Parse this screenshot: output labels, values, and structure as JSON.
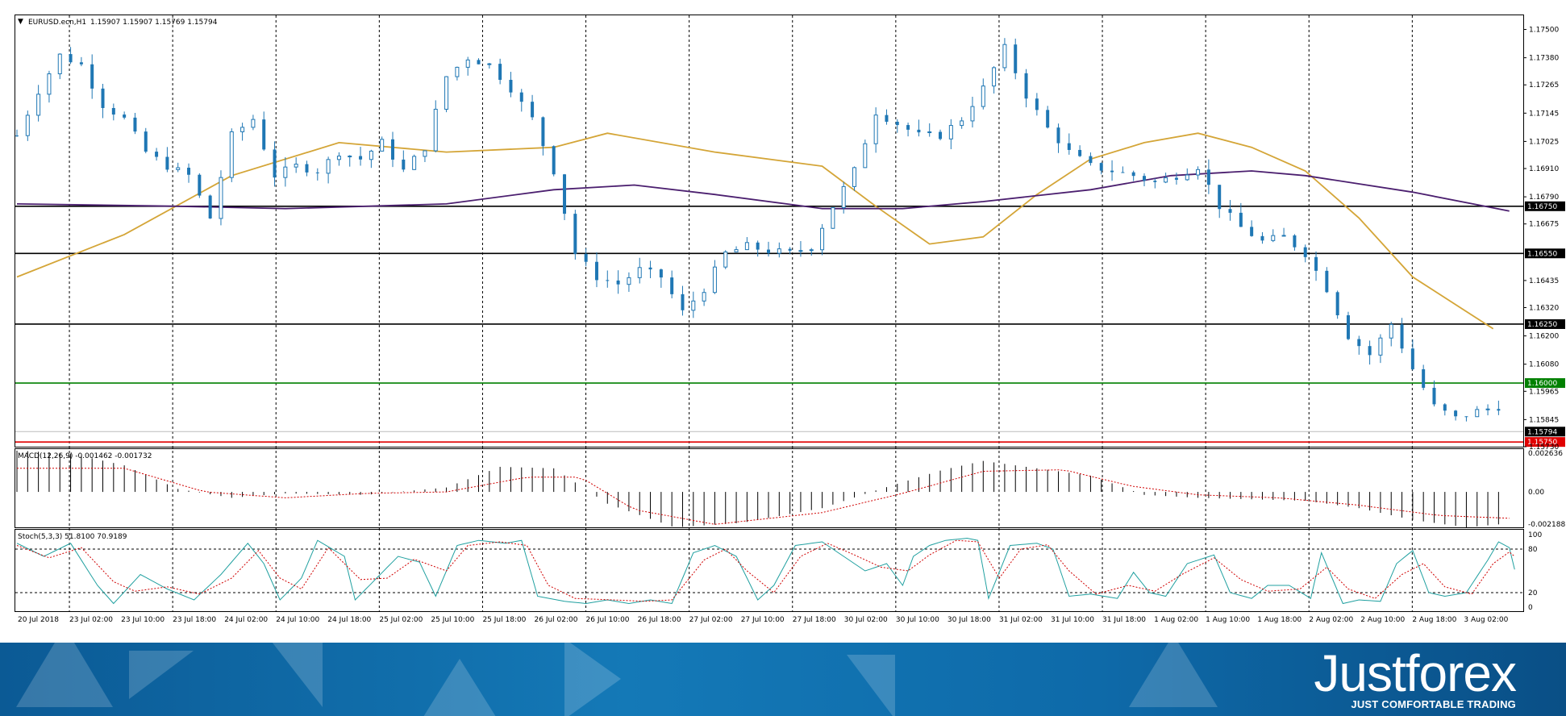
{
  "window": {
    "symbol_title": "EURUSD.ecn,H1",
    "ohlc": "1.15907 1.15907 1.15769 1.15794"
  },
  "indicators": {
    "macd_label": "MACD(12,26,9) -0.001462 -0.001732",
    "stoch_label": "Stoch(5,3,3) 51.8100 70.9189"
  },
  "brand": {
    "name": "Justforex",
    "tagline": "JUST COMFORTABLE TRADING"
  },
  "colors": {
    "candle": "#1f77b4",
    "ma_fast": "#d4a537",
    "ma_slow": "#4b1f6f",
    "support_line": "#000000",
    "green_level": "#008000",
    "red_level": "#e00000",
    "macd_signal": "#d00000",
    "stoch_main": "#20a0a0",
    "stoch_signal": "#d00000"
  },
  "chart_data": [
    {
      "type": "candlestick",
      "title": "EURUSD.ecn,H1",
      "ylim": [
        1.1573,
        1.1756
      ],
      "y_ticks": [
        "1.17500",
        "1.17380",
        "1.17265",
        "1.17145",
        "1.17025",
        "1.16910",
        "1.16790",
        "1.16675",
        "1.16435",
        "1.16320",
        "1.16200",
        "1.16080",
        "1.15965",
        "1.15845",
        "1.15730"
      ],
      "x_ticks": [
        "20 Jul 2018",
        "23 Jul 02:00",
        "23 Jul 10:00",
        "23 Jul 18:00",
        "24 Jul 02:00",
        "24 Jul 10:00",
        "24 Jul 18:00",
        "25 Jul 02:00",
        "25 Jul 10:00",
        "25 Jul 18:00",
        "26 Jul 02:00",
        "26 Jul 10:00",
        "26 Jul 18:00",
        "27 Jul 02:00",
        "27 Jul 10:00",
        "27 Jul 18:00",
        "30 Jul 02:00",
        "30 Jul 10:00",
        "30 Jul 18:00",
        "31 Jul 02:00",
        "31 Jul 10:00",
        "31 Jul 18:00",
        "1 Aug 02:00",
        "1 Aug 10:00",
        "1 Aug 18:00",
        "2 Aug 02:00",
        "2 Aug 10:00",
        "2 Aug 18:00",
        "3 Aug 02:00"
      ],
      "horizontal_levels": [
        {
          "value": 1.1675,
          "label": "1.16750",
          "color": "#000000"
        },
        {
          "value": 1.1655,
          "label": "1.16550",
          "color": "#000000"
        },
        {
          "value": 1.1625,
          "label": "1.16250",
          "color": "#000000"
        },
        {
          "value": 1.16,
          "label": "1.16000",
          "color": "#008000"
        },
        {
          "value": 1.1575,
          "label": "1.15750",
          "color": "#e00000"
        }
      ],
      "current_price": {
        "value": 1.15794,
        "label": "1.15794"
      },
      "close_path": [
        [
          0,
          1.1705
        ],
        [
          8,
          1.1724
        ],
        [
          16,
          1.1739
        ],
        [
          24,
          1.1735
        ],
        [
          32,
          1.1718
        ],
        [
          40,
          1.1712
        ],
        [
          48,
          1.1698
        ],
        [
          56,
          1.1692
        ],
        [
          64,
          1.1688
        ],
        [
          72,
          1.167
        ],
        [
          80,
          1.1705
        ],
        [
          88,
          1.1712
        ],
        [
          96,
          1.1688
        ],
        [
          104,
          1.1692
        ],
        [
          112,
          1.169
        ],
        [
          120,
          1.1698
        ],
        [
          128,
          1.1695
        ],
        [
          136,
          1.1702
        ],
        [
          144,
          1.169
        ],
        [
          152,
          1.17
        ],
        [
          160,
          1.173
        ],
        [
          168,
          1.1738
        ],
        [
          176,
          1.1735
        ],
        [
          184,
          1.1725
        ],
        [
          192,
          1.1712
        ],
        [
          200,
          1.169
        ],
        [
          208,
          1.1655
        ],
        [
          216,
          1.1645
        ],
        [
          224,
          1.1642
        ],
        [
          232,
          1.1648
        ],
        [
          240,
          1.1645
        ],
        [
          248,
          1.163
        ],
        [
          256,
          1.164
        ],
        [
          264,
          1.1655
        ],
        [
          272,
          1.1658
        ],
        [
          280,
          1.1656
        ],
        [
          288,
          1.1655
        ],
        [
          296,
          1.1658
        ],
        [
          304,
          1.1675
        ],
        [
          312,
          1.169
        ],
        [
          320,
          1.1715
        ],
        [
          328,
          1.171
        ],
        [
          336,
          1.1705
        ],
        [
          344,
          1.1705
        ],
        [
          352,
          1.1712
        ],
        [
          360,
          1.1725
        ],
        [
          368,
          1.1742
        ],
        [
          376,
          1.1722
        ],
        [
          384,
          1.1708
        ],
        [
          392,
          1.1698
        ],
        [
          400,
          1.1692
        ],
        [
          408,
          1.169
        ],
        [
          416,
          1.1688
        ],
        [
          424,
          1.1685
        ],
        [
          432,
          1.1688
        ],
        [
          440,
          1.1692
        ],
        [
          448,
          1.1675
        ],
        [
          456,
          1.1666
        ],
        [
          464,
          1.166
        ],
        [
          472,
          1.1662
        ],
        [
          480,
          1.1655
        ],
        [
          488,
          1.164
        ],
        [
          496,
          1.162
        ],
        [
          504,
          1.1612
        ],
        [
          512,
          1.1625
        ],
        [
          520,
          1.1606
        ],
        [
          528,
          1.159
        ],
        [
          536,
          1.1585
        ],
        [
          544,
          1.1588
        ],
        [
          552,
          1.159
        ],
        [
          558,
          1.1579
        ]
      ],
      "series": [
        {
          "name": "",
          "color": "#d4a537",
          "values": [
            [
              0,
              1.1645
            ],
            [
              40,
              1.1663
            ],
            [
              80,
              1.1688
            ],
            [
              120,
              1.1702
            ],
            [
              160,
              1.1698
            ],
            [
              200,
              1.17
            ],
            [
              220,
              1.1706
            ],
            [
              260,
              1.1698
            ],
            [
              300,
              1.1692
            ],
            [
              320,
              1.1675
            ],
            [
              340,
              1.1659
            ],
            [
              360,
              1.1662
            ],
            [
              380,
              1.168
            ],
            [
              400,
              1.1695
            ],
            [
              420,
              1.1702
            ],
            [
              440,
              1.1706
            ],
            [
              460,
              1.17
            ],
            [
              480,
              1.169
            ],
            [
              500,
              1.167
            ],
            [
              520,
              1.1645
            ],
            [
              550,
              1.1623
            ]
          ]
        },
        {
          "name": "",
          "color": "#4b1f6f",
          "values": [
            [
              0,
              1.1676
            ],
            [
              60,
              1.1675
            ],
            [
              100,
              1.1674
            ],
            [
              160,
              1.1676
            ],
            [
              200,
              1.1682
            ],
            [
              230,
              1.1684
            ],
            [
              260,
              1.168
            ],
            [
              300,
              1.1674
            ],
            [
              330,
              1.1674
            ],
            [
              360,
              1.1677
            ],
            [
              400,
              1.1682
            ],
            [
              430,
              1.1688
            ],
            [
              460,
              1.169
            ],
            [
              480,
              1.1688
            ],
            [
              520,
              1.1681
            ],
            [
              556,
              1.1673
            ]
          ]
        }
      ]
    },
    {
      "type": "histogram",
      "title": "MACD(12,26,9) -0.001462 -0.001732",
      "ylim": [
        -0.0024,
        0.0029
      ],
      "y_ticks": [
        "0.002636",
        "0.00",
        "-0.002188"
      ],
      "macd_path": [
        [
          0,
          0.0028
        ],
        [
          20,
          0.0026
        ],
        [
          40,
          0.0018
        ],
        [
          60,
          0.0002
        ],
        [
          80,
          -0.0004
        ],
        [
          100,
          -0.0001
        ],
        [
          130,
          -0.0002
        ],
        [
          160,
          0.0003
        ],
        [
          180,
          0.0017
        ],
        [
          200,
          0.0016
        ],
        [
          220,
          -0.0008
        ],
        [
          245,
          -0.0024
        ],
        [
          270,
          -0.0021
        ],
        [
          300,
          -0.0011
        ],
        [
          320,
          0.0001
        ],
        [
          345,
          0.0015
        ],
        [
          360,
          0.0021
        ],
        [
          380,
          0.0016
        ],
        [
          400,
          0.0011
        ],
        [
          420,
          -0.0002
        ],
        [
          440,
          -0.0004
        ],
        [
          460,
          -0.0005
        ],
        [
          480,
          -0.0006
        ],
        [
          500,
          -0.0011
        ],
        [
          520,
          -0.0019
        ],
        [
          540,
          -0.0024
        ],
        [
          558,
          -0.0021
        ]
      ],
      "signal_path": [
        [
          0,
          0.0016
        ],
        [
          40,
          0.0016
        ],
        [
          70,
          0.0
        ],
        [
          100,
          -0.0004
        ],
        [
          130,
          -0.0001
        ],
        [
          160,
          0.0
        ],
        [
          190,
          0.001
        ],
        [
          210,
          0.001
        ],
        [
          230,
          -0.0012
        ],
        [
          260,
          -0.0022
        ],
        [
          300,
          -0.0014
        ],
        [
          330,
          -0.0001
        ],
        [
          360,
          0.0014
        ],
        [
          390,
          0.0015
        ],
        [
          415,
          0.0004
        ],
        [
          440,
          -0.0002
        ],
        [
          470,
          -0.0004
        ],
        [
          500,
          -0.0009
        ],
        [
          530,
          -0.0016
        ],
        [
          558,
          -0.0018
        ]
      ]
    },
    {
      "type": "line",
      "title": "Stoch(5,3,3) 51.8100 70.9189",
      "ylim": [
        0,
        100
      ],
      "y_ticks": [
        "100",
        "80",
        "20",
        "0"
      ],
      "levels": [
        80,
        20
      ],
      "main_path": [
        [
          0,
          88
        ],
        [
          10,
          70
        ],
        [
          20,
          88
        ],
        [
          30,
          30
        ],
        [
          36,
          5
        ],
        [
          46,
          45
        ],
        [
          56,
          25
        ],
        [
          66,
          10
        ],
        [
          76,
          45
        ],
        [
          86,
          88
        ],
        [
          92,
          60
        ],
        [
          98,
          10
        ],
        [
          106,
          40
        ],
        [
          112,
          92
        ],
        [
          122,
          70
        ],
        [
          126,
          10
        ],
        [
          134,
          40
        ],
        [
          142,
          70
        ],
        [
          150,
          62
        ],
        [
          156,
          15
        ],
        [
          164,
          85
        ],
        [
          172,
          92
        ],
        [
          182,
          88
        ],
        [
          188,
          92
        ],
        [
          194,
          15
        ],
        [
          204,
          8
        ],
        [
          212,
          5
        ],
        [
          220,
          10
        ],
        [
          228,
          5
        ],
        [
          236,
          10
        ],
        [
          244,
          5
        ],
        [
          252,
          75
        ],
        [
          260,
          85
        ],
        [
          268,
          70
        ],
        [
          276,
          10
        ],
        [
          282,
          30
        ],
        [
          290,
          85
        ],
        [
          300,
          90
        ],
        [
          308,
          70
        ],
        [
          316,
          50
        ],
        [
          324,
          60
        ],
        [
          330,
          30
        ],
        [
          334,
          70
        ],
        [
          340,
          85
        ],
        [
          346,
          92
        ],
        [
          354,
          95
        ],
        [
          358,
          92
        ],
        [
          362,
          12
        ],
        [
          370,
          85
        ],
        [
          380,
          88
        ],
        [
          386,
          80
        ],
        [
          392,
          15
        ],
        [
          400,
          18
        ],
        [
          410,
          12
        ],
        [
          416,
          48
        ],
        [
          422,
          20
        ],
        [
          428,
          15
        ],
        [
          436,
          60
        ],
        [
          446,
          72
        ],
        [
          452,
          20
        ],
        [
          460,
          12
        ],
        [
          466,
          30
        ],
        [
          474,
          30
        ],
        [
          482,
          12
        ],
        [
          486,
          75
        ],
        [
          494,
          5
        ],
        [
          500,
          10
        ],
        [
          508,
          8
        ],
        [
          514,
          60
        ],
        [
          520,
          78
        ],
        [
          526,
          20
        ],
        [
          532,
          15
        ],
        [
          540,
          20
        ],
        [
          548,
          65
        ],
        [
          552,
          90
        ],
        [
          556,
          82
        ],
        [
          558,
          52
        ]
      ],
      "signal_path": [
        [
          0,
          85
        ],
        [
          12,
          68
        ],
        [
          24,
          82
        ],
        [
          36,
          35
        ],
        [
          44,
          22
        ],
        [
          56,
          28
        ],
        [
          68,
          18
        ],
        [
          80,
          40
        ],
        [
          90,
          78
        ],
        [
          98,
          40
        ],
        [
          106,
          25
        ],
        [
          116,
          82
        ],
        [
          128,
          38
        ],
        [
          138,
          40
        ],
        [
          148,
          66
        ],
        [
          160,
          50
        ],
        [
          168,
          85
        ],
        [
          180,
          90
        ],
        [
          190,
          85
        ],
        [
          198,
          30
        ],
        [
          208,
          12
        ],
        [
          222,
          10
        ],
        [
          234,
          8
        ],
        [
          244,
          10
        ],
        [
          256,
          65
        ],
        [
          264,
          80
        ],
        [
          272,
          50
        ],
        [
          282,
          20
        ],
        [
          292,
          70
        ],
        [
          302,
          88
        ],
        [
          312,
          72
        ],
        [
          322,
          55
        ],
        [
          332,
          50
        ],
        [
          340,
          72
        ],
        [
          350,
          92
        ],
        [
          358,
          90
        ],
        [
          366,
          40
        ],
        [
          374,
          80
        ],
        [
          384,
          86
        ],
        [
          392,
          50
        ],
        [
          402,
          18
        ],
        [
          414,
          30
        ],
        [
          424,
          22
        ],
        [
          434,
          45
        ],
        [
          446,
          68
        ],
        [
          456,
          38
        ],
        [
          466,
          22
        ],
        [
          478,
          25
        ],
        [
          488,
          55
        ],
        [
          496,
          25
        ],
        [
          506,
          12
        ],
        [
          516,
          45
        ],
        [
          524,
          60
        ],
        [
          532,
          28
        ],
        [
          542,
          18
        ],
        [
          550,
          60
        ],
        [
          556,
          76
        ],
        [
          558,
          70
        ]
      ]
    }
  ]
}
